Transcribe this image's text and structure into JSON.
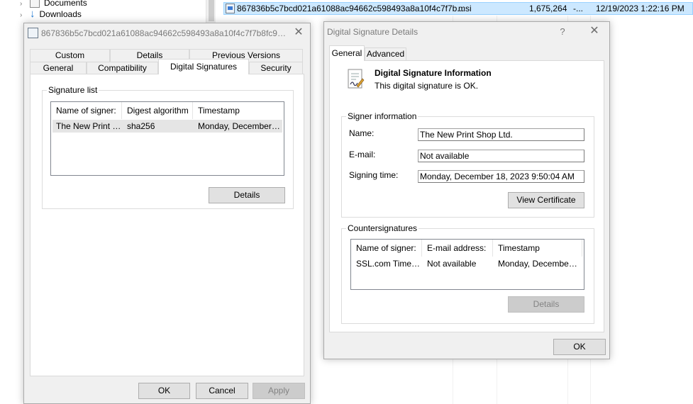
{
  "explorer": {
    "nav_items": [
      {
        "label": "Documents",
        "icon": "documents-icon"
      },
      {
        "label": "Downloads",
        "icon": "downloads-icon"
      }
    ],
    "file_row": {
      "name": "867836b5c7bcd021a61088ac94662c598493a8a10f4c7f7b...",
      "type": "msi",
      "size": "1,675,264",
      "attr": "-...",
      "date": "12/19/2023 1:22:16 PM"
    }
  },
  "properties": {
    "title": "867836b5c7bcd021a61088ac94662c598493a8a10f4c7f7b8fc992f6...",
    "tabs_row1": [
      "Custom",
      "Details",
      "Previous Versions"
    ],
    "tabs_row2": [
      "General",
      "Compatibility",
      "Digital Signatures",
      "Security"
    ],
    "signature_list_label": "Signature list",
    "columns": [
      "Name of signer:",
      "Digest algorithm",
      "Timestamp"
    ],
    "rows": [
      {
        "signer": "The New Print S...",
        "digest": "sha256",
        "timestamp": "Monday, December 1..."
      }
    ],
    "details_button": "Details",
    "ok": "OK",
    "cancel": "Cancel",
    "apply": "Apply"
  },
  "details_dialog": {
    "title": "Digital Signature Details",
    "help": "?",
    "tabs": [
      "General",
      "Advanced"
    ],
    "info_heading": "Digital Signature Information",
    "info_status": "This digital signature is OK.",
    "signer_group": "Signer information",
    "name_label": "Name:",
    "name_value": "The New Print Shop Ltd.",
    "email_label": "E-mail:",
    "email_value": "Not available",
    "signing_time_label": "Signing time:",
    "signing_time_value": "Monday, December 18, 2023 9:50:04 AM",
    "view_certificate": "View Certificate",
    "countersig_group": "Countersignatures",
    "cs_columns": [
      "Name of signer:",
      "E-mail address:",
      "Timestamp"
    ],
    "cs_rows": [
      {
        "signer": "SSL.com Timesta...",
        "email": "Not available",
        "timestamp": "Monday, December ..."
      }
    ],
    "cs_details": "Details",
    "ok": "OK"
  },
  "colors": {
    "selection": "#cce8ff",
    "dialog_bg": "#f0f0f0",
    "accent": "#0078d7"
  }
}
